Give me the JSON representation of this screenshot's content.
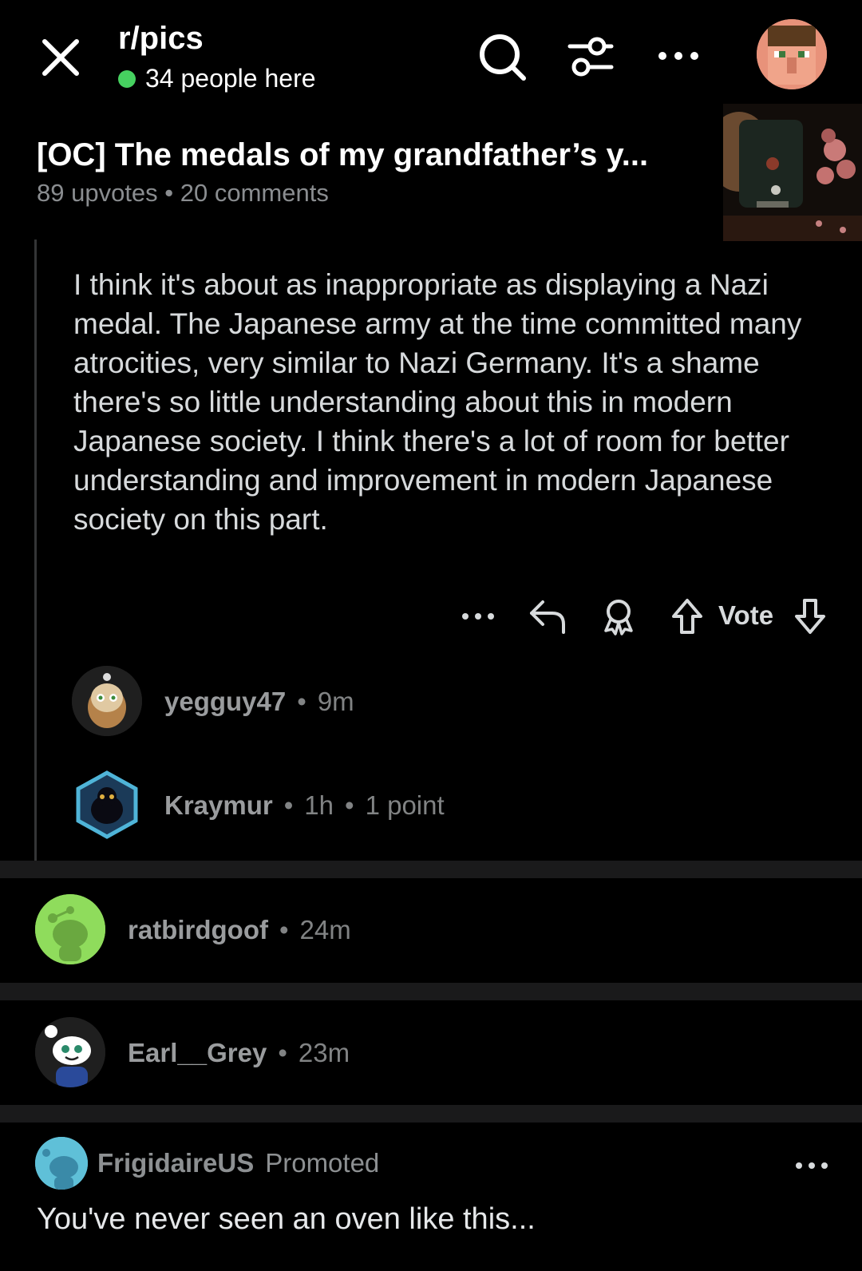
{
  "header": {
    "subreddit": "r/pics",
    "online_count": "34 people here"
  },
  "post": {
    "title": "[OC] The medals of my grandfather’s y...",
    "upvotes": "89 upvotes",
    "comments": "20 comments"
  },
  "comment": {
    "text": "I think it's about as inappropriate as displaying a Nazi medal. The Japanese army at the time committed many atrocities, very similar to Nazi Germany. It's a shame there's so little understanding about this in modern Japanese society. I think there's a lot of room for better understanding and improvement in modern Japanese society on this part.",
    "vote_label": "Vote"
  },
  "collapsed_comments": [
    {
      "user": "yegguy47",
      "time": "9m",
      "points": ""
    },
    {
      "user": "Kraymur",
      "time": "1h",
      "points": "1 point"
    },
    {
      "user": "ratbirdgoof",
      "time": "24m",
      "points": ""
    },
    {
      "user": "Earl__Grey",
      "time": "23m",
      "points": ""
    }
  ],
  "promoted": {
    "advertiser": "FrigidaireUS",
    "tag": "Promoted",
    "text": "You've never seen an oven like this..."
  },
  "colors": {
    "background": "#000000",
    "online_dot": "#46d160",
    "divider": "#1a1a1b",
    "muted_text": "#818384"
  },
  "icons": [
    "close-icon",
    "search-icon",
    "filter-icon",
    "more-icon",
    "reply-icon",
    "award-icon",
    "upvote-icon",
    "downvote-icon"
  ]
}
